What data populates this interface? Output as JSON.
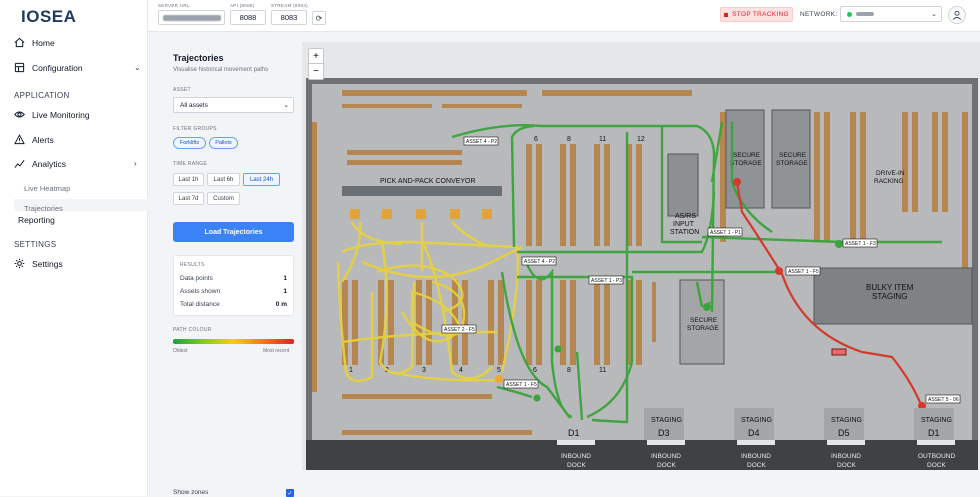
{
  "app": {
    "logo": "IOSEA"
  },
  "sidebar": {
    "home": "Home",
    "configuration": "Configuration",
    "section_application": "APPLICATION",
    "live_monitoring": "Live Monitoring",
    "alerts": "Alerts",
    "analytics": "Analytics",
    "live_heatmap": "Live Heatmap",
    "trajectories": "Trajectories",
    "reporting": "Reporting",
    "section_settings": "SETTINGS",
    "settings": "Settings"
  },
  "topbar": {
    "server_url_label": "SERVER URL",
    "api_label": "API (8088)",
    "api_value": "8088",
    "stream_label": "STREAM (8083)",
    "stream_value": "8083",
    "stop_tracking": "STOP TRACKING",
    "network_label": "NETWORK:"
  },
  "panel": {
    "title": "Trajectories",
    "subtitle": "Visualise historical movement paths",
    "asset_label": "ASSET",
    "asset_value": "All assets",
    "filter_groups_label": "FILTER GROUPS",
    "filter_groups": [
      "Forklifts",
      "Pallets"
    ],
    "time_range_label": "TIME RANGE",
    "time_ranges": [
      "Last 1h",
      "Last 6h",
      "Last 24h",
      "Last 7d",
      "Custom"
    ],
    "load_button": "Load Trajectories",
    "results_label": "RESULTS",
    "results": [
      {
        "label": "Data points",
        "value": "1"
      },
      {
        "label": "Assets shown",
        "value": "1"
      },
      {
        "label": "Total distance",
        "value": "0 m"
      }
    ],
    "path_colour_label": "PATH COLOUR",
    "oldest": "Oldest",
    "most_recent": "Most recent",
    "show_zones": "Show zones"
  },
  "map": {
    "zoom_in": "+",
    "zoom_out": "−",
    "conveyor_label": "PICK AND-PACK CONVEYOR",
    "asrs_label": [
      "AS/RS",
      "INPUT",
      "STATION"
    ],
    "secure_storage": [
      "SECURE",
      "STORAGE"
    ],
    "drive_in": [
      "DRIVE-IN",
      "RACKING"
    ],
    "bulky": [
      "BULKY ITEM",
      "STAGING"
    ],
    "aisle_numbers_top": [
      "6",
      "8",
      "11",
      "12"
    ],
    "aisle_numbers_bottom": [
      "1",
      "2",
      "3",
      "4",
      "5",
      "6",
      "8",
      "11"
    ],
    "docks": [
      {
        "label": "D1",
        "caption": [
          "INBOUND",
          "DOCK"
        ],
        "staging": ""
      },
      {
        "label": "D3",
        "caption": [
          "INBOUND",
          "DOCK"
        ],
        "staging": "STAGING"
      },
      {
        "label": "D4",
        "caption": [
          "INBOUND",
          "DOCK"
        ],
        "staging": "STAGING"
      },
      {
        "label": "D5",
        "caption": [
          "INBOUND",
          "DOCK"
        ],
        "staging": "STAGING"
      },
      {
        "label": "D1",
        "caption": [
          "OUTBOUND",
          "DOCK"
        ],
        "staging": "STAGING"
      }
    ],
    "asset_tags": [
      "ASSET 4 - P2",
      "ASSET 4 - P2",
      "ASSET 1 - P1",
      "ASSET 1 - P3",
      "ASSET 1 - F3",
      "ASSET 1 - F5",
      "ASSET 2 - F5",
      "ASSET 1 - F5",
      "ASSET 5 - 06"
    ]
  }
}
